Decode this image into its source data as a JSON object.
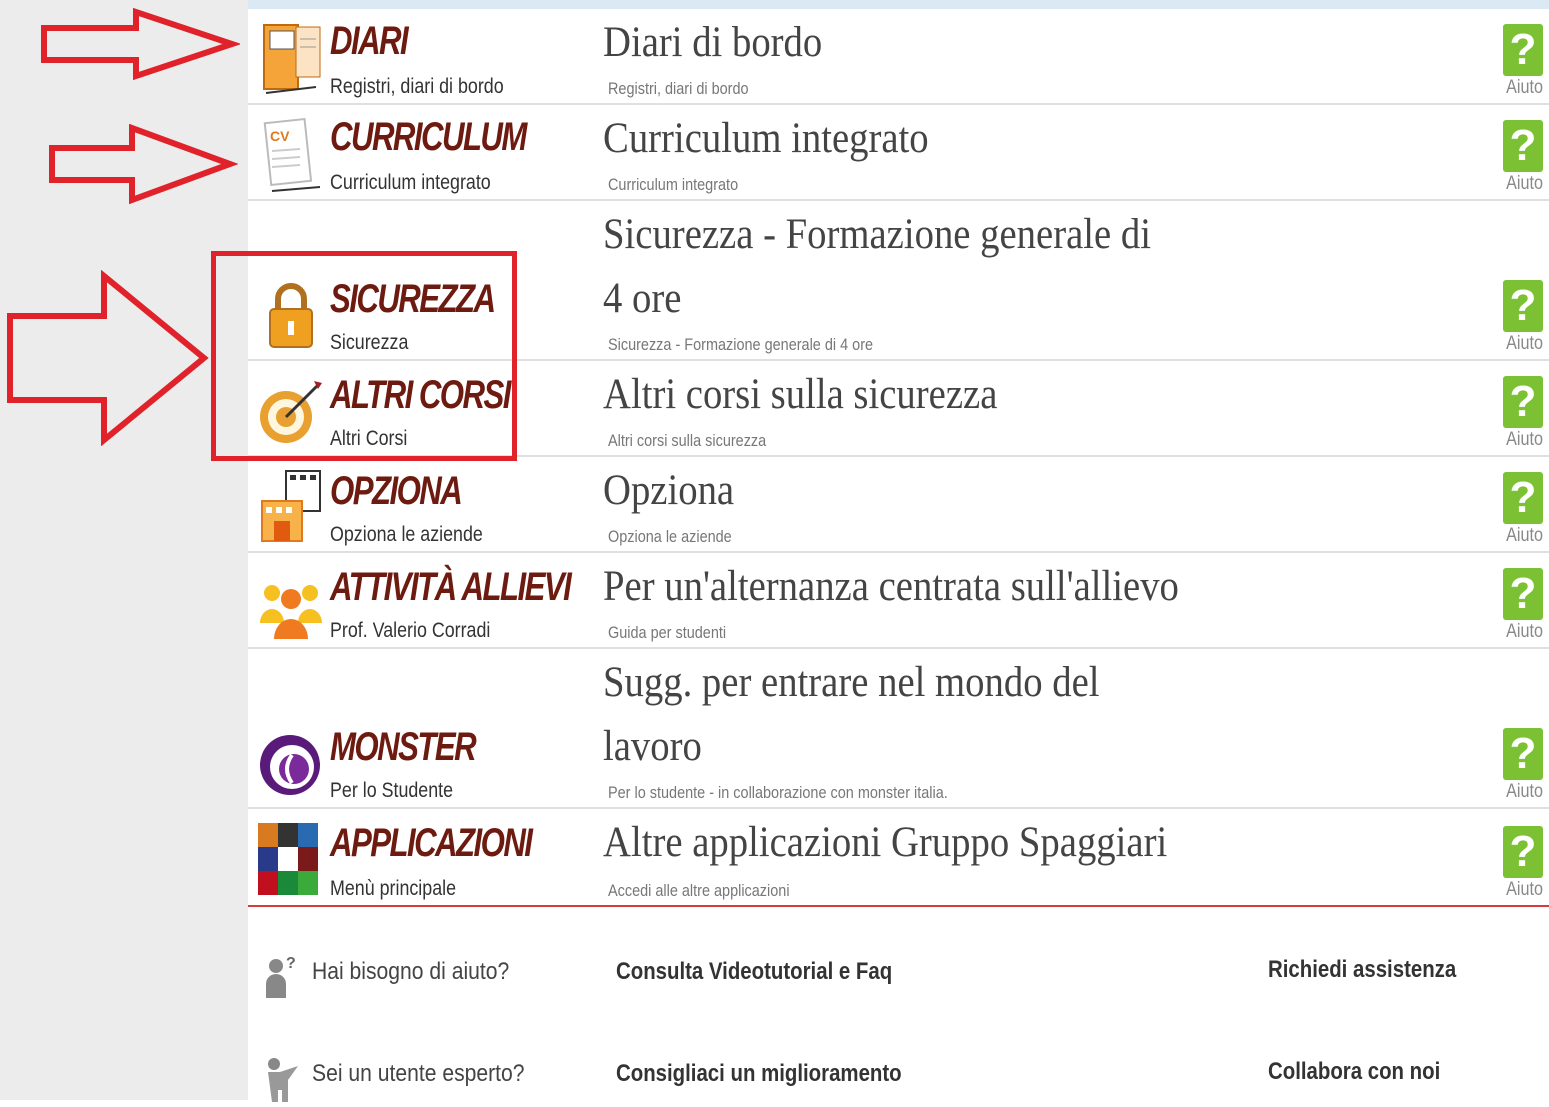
{
  "rows": [
    {
      "title": "DIARI",
      "subtitle": "Registri, diari di bordo",
      "desc": "Diari di bordo",
      "small": "Registri, diari di bordo",
      "icon": "notebook-icon"
    },
    {
      "title": "CURRICULUM",
      "subtitle": "Curriculum integrato",
      "desc": "Curriculum integrato",
      "small": "Curriculum integrato",
      "icon": "cv-document-icon"
    },
    {
      "title": "SICUREZZA",
      "subtitle": "Sicurezza",
      "desc": "Sicurezza - Formazione generale di 4 ore",
      "small": "Sicurezza - Formazione generale di 4 ore",
      "icon": "padlock-icon"
    },
    {
      "title": "ALTRI CORSI",
      "subtitle": "Altri Corsi",
      "desc": "Altri corsi sulla sicurezza",
      "small": "Altri corsi sulla sicurezza",
      "icon": "target-icon"
    },
    {
      "title": "OPZIONA",
      "subtitle": "Opziona le aziende",
      "desc": "Opziona",
      "small": "Opziona le aziende",
      "icon": "buildings-icon"
    },
    {
      "title": "ATTIVITÀ ALLIEVI",
      "subtitle": "Prof. Valerio Corradi",
      "desc": "Per un'alternanza centrata sull'allievo",
      "small": "Guida per studenti",
      "icon": "students-icon"
    },
    {
      "title": "MONSTER",
      "subtitle": "Per lo Studente",
      "desc": "Sugg. per entrare nel mondo del lavoro",
      "small": "Per lo studente - in collaborazione con monster italia.",
      "icon": "monster-logo-icon"
    },
    {
      "title": "APPLICAZIONI",
      "subtitle": "Menù principale",
      "desc": "Altre applicazioni Gruppo Spaggiari",
      "small": "Accedi alle altre applicazioni",
      "icon": "apps-grid-icon"
    }
  ],
  "help": {
    "symbol": "?",
    "label": "Aiuto"
  },
  "footer": {
    "row1": {
      "label": "Hai bisogno di aiuto?",
      "link1": "Consulta Videotutorial e Faq",
      "link2": "Richiedi assistenza"
    },
    "row2": {
      "label": "Sei un utente esperto?",
      "link1": "Consigliaci un miglioramento",
      "link2": "Collabora con noi"
    }
  },
  "colors": {
    "title": "#6d1a10",
    "help_button": "#7cc034",
    "highlight": "#e0222b"
  }
}
